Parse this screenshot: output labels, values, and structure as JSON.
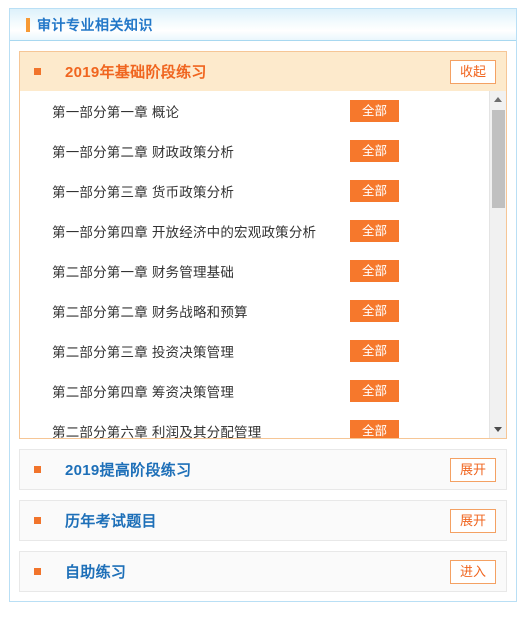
{
  "card": {
    "title": "审计专业相关知识",
    "accent_blue": "#2277c8",
    "accent_orange": "#f0651f"
  },
  "sections": [
    {
      "title": "2019年基础阶段练习",
      "state": "expanded",
      "toggle_label": "收起",
      "items": [
        {
          "label": "第一部分第一章  概论",
          "action_label": "全部"
        },
        {
          "label": "第一部分第二章  财政政策分析",
          "action_label": "全部"
        },
        {
          "label": "第一部分第三章  货币政策分析",
          "action_label": "全部"
        },
        {
          "label": "第一部分第四章  开放经济中的宏观政策分析",
          "action_label": "全部"
        },
        {
          "label": "第二部分第一章  财务管理基础",
          "action_label": "全部"
        },
        {
          "label": "第二部分第二章  财务战略和预算",
          "action_label": "全部"
        },
        {
          "label": "第二部分第三章  投资决策管理",
          "action_label": "全部"
        },
        {
          "label": "第二部分第四章  筹资决策管理",
          "action_label": "全部"
        },
        {
          "label": "第二部分第六章  利润及其分配管理",
          "action_label": "全部"
        }
      ]
    },
    {
      "title": "2019提高阶段练习",
      "state": "collapsed",
      "toggle_label": "展开"
    },
    {
      "title": "历年考试题目",
      "state": "collapsed",
      "toggle_label": "展开"
    },
    {
      "title": "自助练习",
      "state": "collapsed",
      "toggle_label": "进入"
    }
  ],
  "scrollbar": {
    "up_arrow": "scroll-up-arrow",
    "down_arrow": "scroll-down-arrow"
  }
}
